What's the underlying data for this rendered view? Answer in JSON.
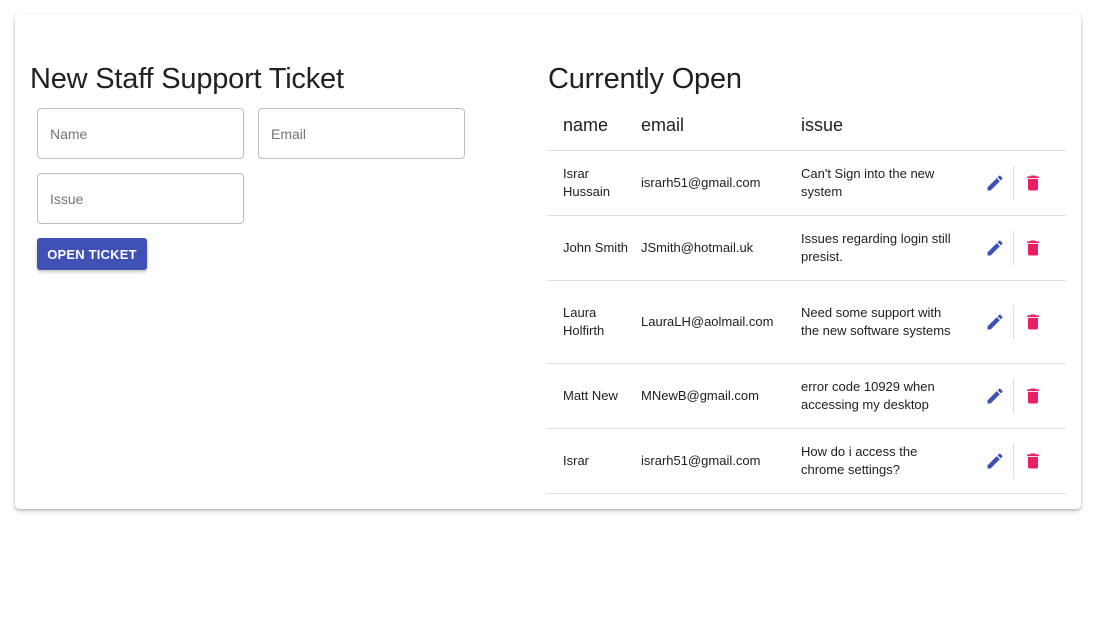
{
  "form": {
    "title": "New Staff Support Ticket",
    "name_placeholder": "Name",
    "email_placeholder": "Email",
    "issue_placeholder": "Issue",
    "submit_label": "OPEN TICKET"
  },
  "tickets": {
    "title": "Currently Open",
    "columns": {
      "name": "name",
      "email": "email",
      "issue": "issue"
    },
    "rows": [
      {
        "name": "Israr Hussain",
        "email": "israrh51@gmail.com",
        "issue": "Can't Sign into the new system"
      },
      {
        "name": "John Smith",
        "email": "JSmith@hotmail.uk",
        "issue": "Issues regarding login still presist."
      },
      {
        "name": "Laura Holfirth",
        "email": "LauraLH@aolmail.com",
        "issue": "Need some support with the new software systems"
      },
      {
        "name": "Matt New",
        "email": "MNewB@gmail.com",
        "issue": "error code 10929 when accessing my desktop"
      },
      {
        "name": "Israr",
        "email": "israrh51@gmail.com",
        "issue": "How do i access the chrome settings?"
      }
    ],
    "row_actions": {
      "edit_icon": "pencil-icon",
      "delete_icon": "trash-icon"
    }
  },
  "colors": {
    "primary": "#3f51b5",
    "danger": "#e91e63",
    "divider": "#e0e0e0"
  }
}
